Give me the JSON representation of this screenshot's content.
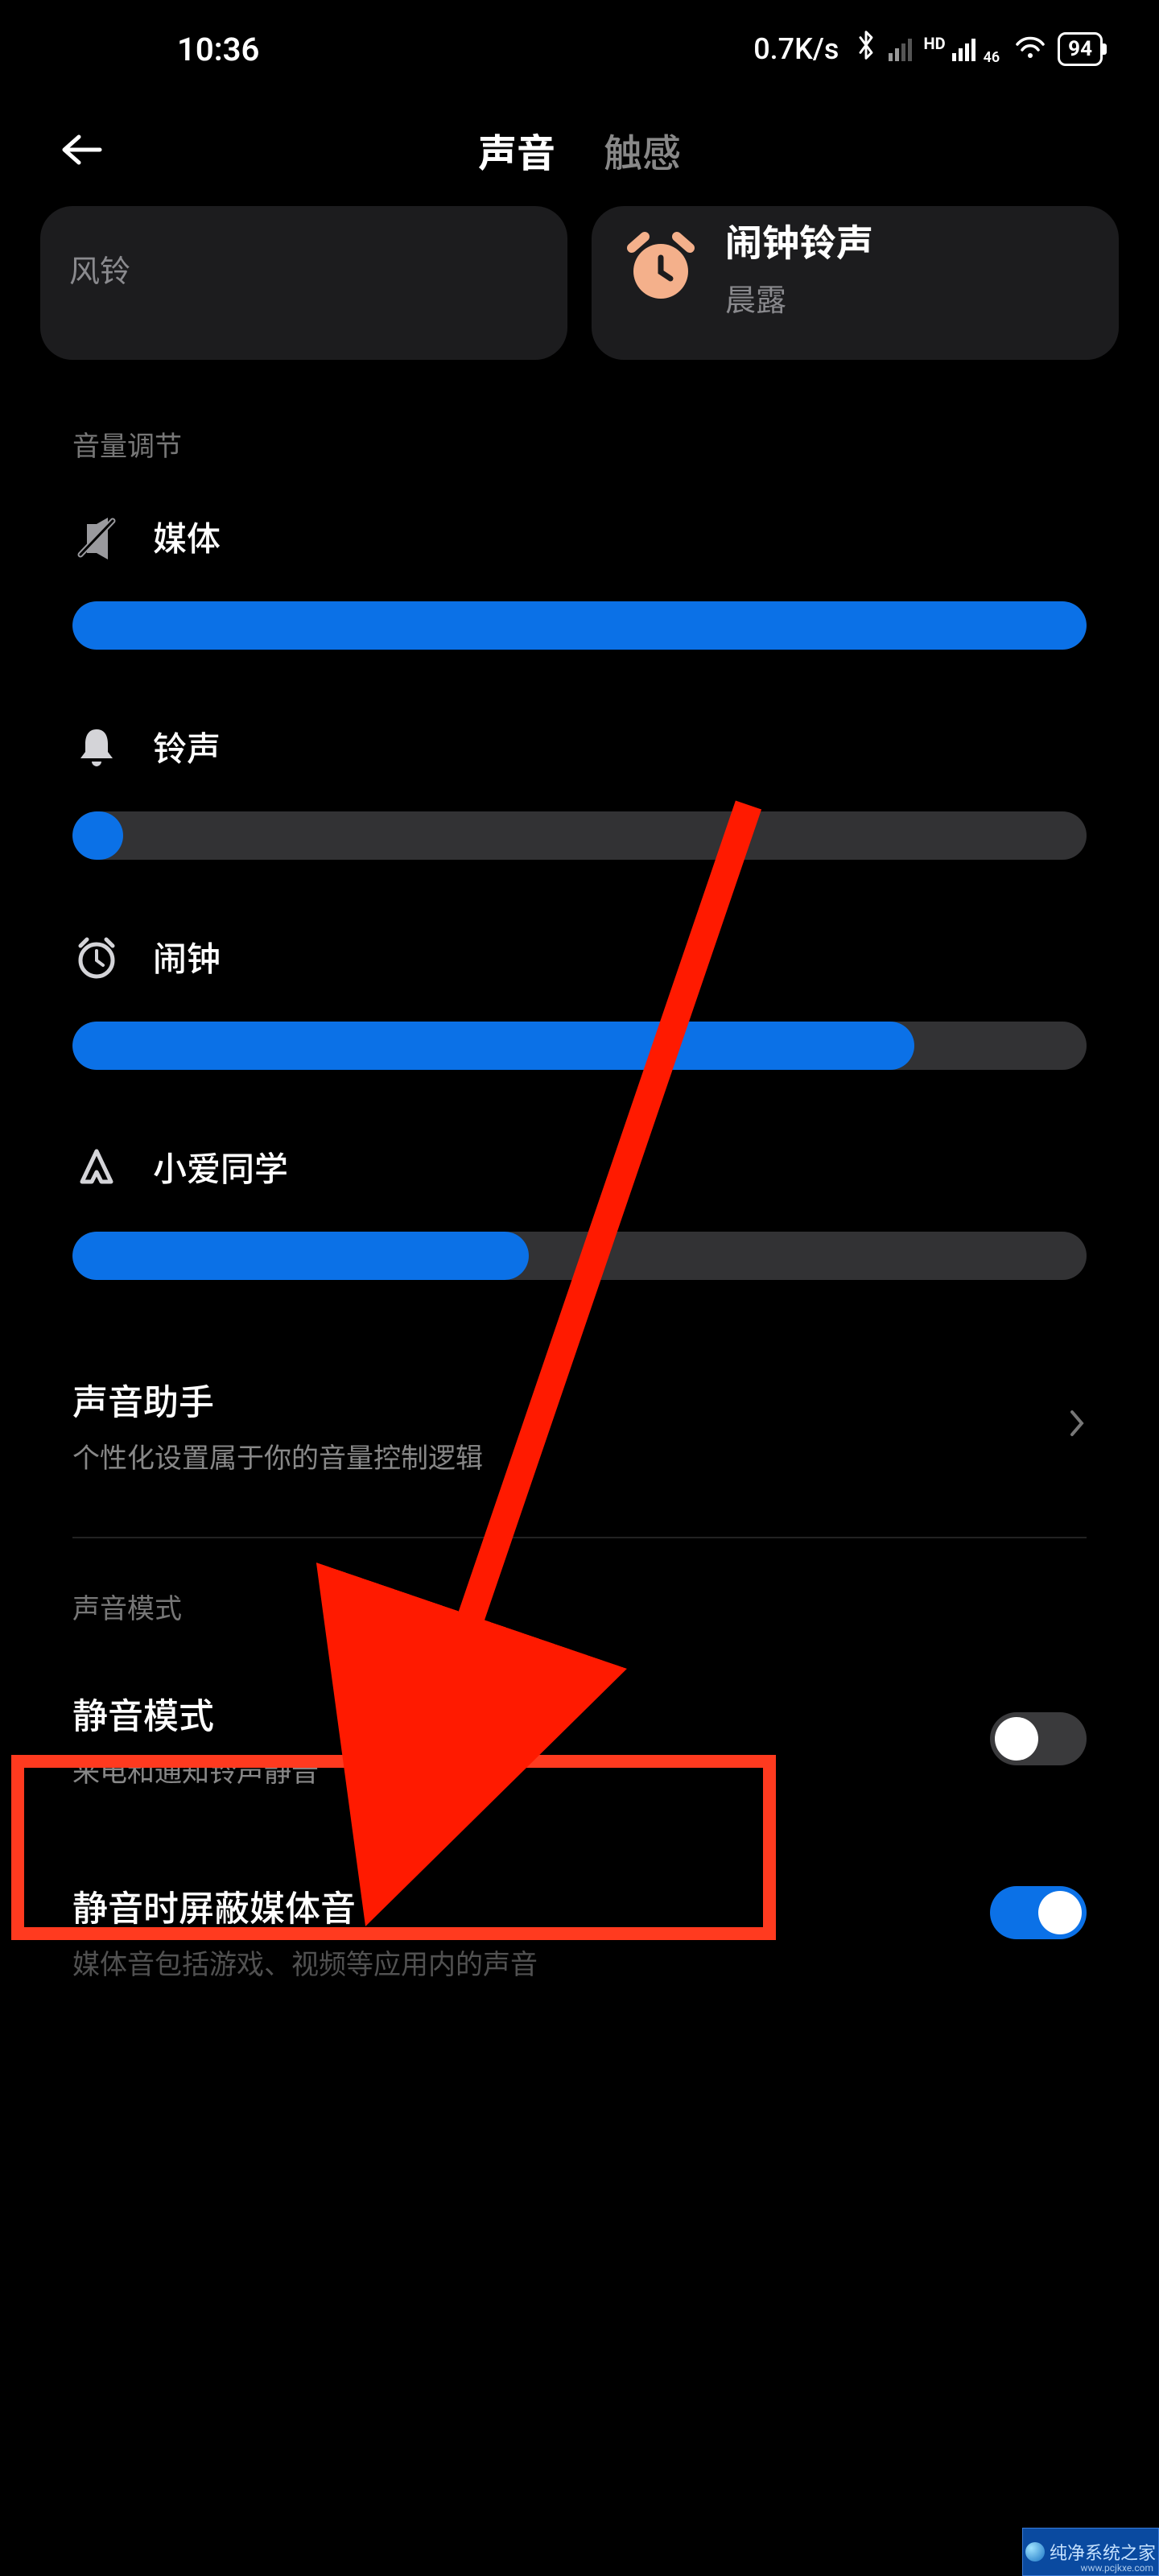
{
  "status": {
    "time": "10:36",
    "speed": "0.7K/s",
    "hd_label": "HD",
    "sig_sub": "46",
    "battery": "94"
  },
  "header": {
    "tab_active": "声音",
    "tab_inactive": "触感"
  },
  "cards": {
    "left_sub": "风铃",
    "right_title": "闹钟铃声",
    "right_sub": "晨露"
  },
  "section_volume": "音量调节",
  "sliders": {
    "media": {
      "label": "媒体",
      "percent": 100
    },
    "ringtone": {
      "label": "铃声",
      "percent": 5
    },
    "alarm": {
      "label": "闹钟",
      "percent": 83
    },
    "xiaoai": {
      "label": "小爱同学",
      "percent": 45
    }
  },
  "sound_assistant": {
    "title": "声音助手",
    "subtitle": "个性化设置属于你的音量控制逻辑"
  },
  "section_mode": "声音模式",
  "silent": {
    "title": "静音模式",
    "subtitle": "来电和通知铃声静音",
    "on": false
  },
  "silent_media": {
    "title": "静音时屏蔽媒体音",
    "subtitle": "媒体音包括游戏、视频等应用内的声音",
    "on": true
  },
  "watermark": {
    "text": "纯净系统之家",
    "url": "www.pcjkxe.com"
  }
}
